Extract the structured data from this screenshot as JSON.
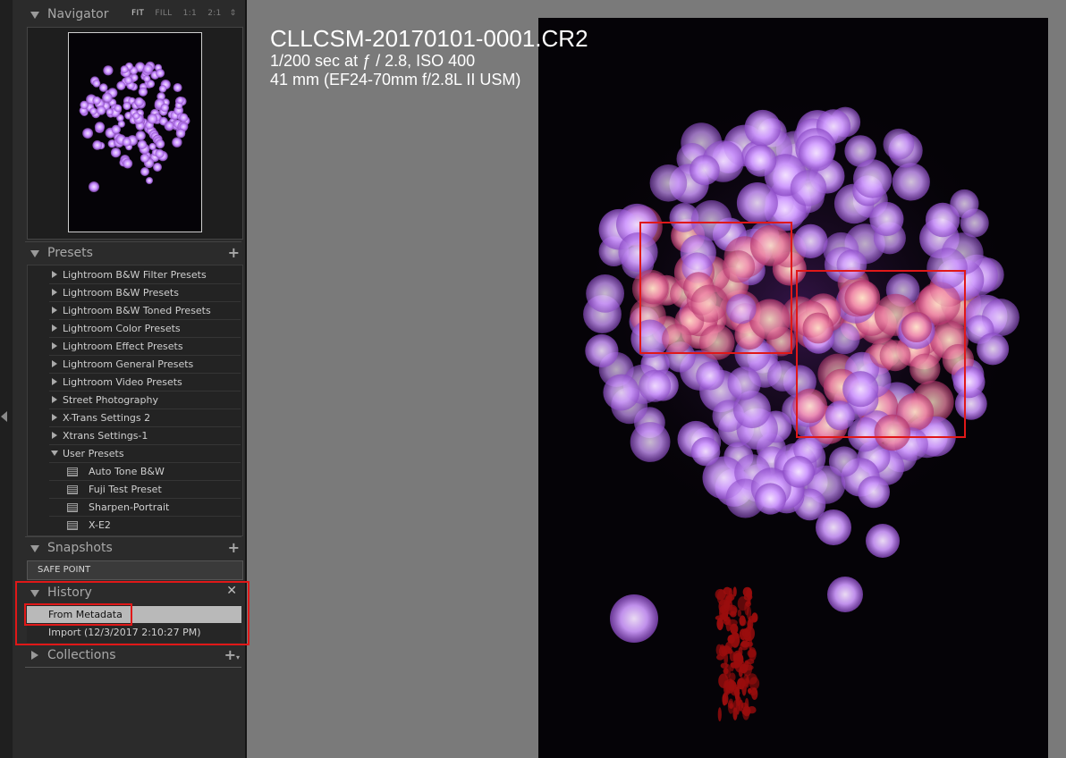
{
  "navigator": {
    "title": "Navigator",
    "zoom_options": [
      "FIT",
      "FILL",
      "1:1",
      "2:1"
    ],
    "active_zoom": "FIT"
  },
  "presets": {
    "title": "Presets",
    "items": [
      {
        "label": "Lightroom B&W Filter Presets",
        "type": "folder"
      },
      {
        "label": "Lightroom B&W Presets",
        "type": "folder"
      },
      {
        "label": "Lightroom B&W Toned Presets",
        "type": "folder"
      },
      {
        "label": "Lightroom Color Presets",
        "type": "folder"
      },
      {
        "label": "Lightroom Effect Presets",
        "type": "folder"
      },
      {
        "label": "Lightroom General Presets",
        "type": "folder"
      },
      {
        "label": "Lightroom Video Presets",
        "type": "folder"
      },
      {
        "label": "Street Photography",
        "type": "folder"
      },
      {
        "label": "X-Trans Settings 2",
        "type": "folder"
      },
      {
        "label": "Xtrans Settings-1",
        "type": "folder"
      },
      {
        "label": "User Presets",
        "type": "folder-open"
      },
      {
        "label": "Auto Tone B&W",
        "type": "preset"
      },
      {
        "label": "Fuji Test Preset",
        "type": "preset"
      },
      {
        "label": "Sharpen-Portrait",
        "type": "preset"
      },
      {
        "label": "X-E2",
        "type": "preset"
      }
    ]
  },
  "snapshots": {
    "title": "Snapshots",
    "items": [
      "SAFE POINT"
    ]
  },
  "history": {
    "title": "History",
    "items": [
      "From Metadata",
      "Import (12/3/2017 2:10:27 PM)"
    ],
    "selected_index": 0
  },
  "collections": {
    "title": "Collections"
  },
  "photo_info": {
    "filename": "CLLCSM-20170101-0001.CR2",
    "exposure": "1/200 sec at ƒ / 2.8, ISO 400",
    "lens": "41 mm (EF24-70mm f/2.8L II USM)"
  },
  "colors": {
    "highlight_box": "#e01818",
    "bokeh": "#d9a6ff",
    "panel_bg": "#2b2b2b"
  }
}
